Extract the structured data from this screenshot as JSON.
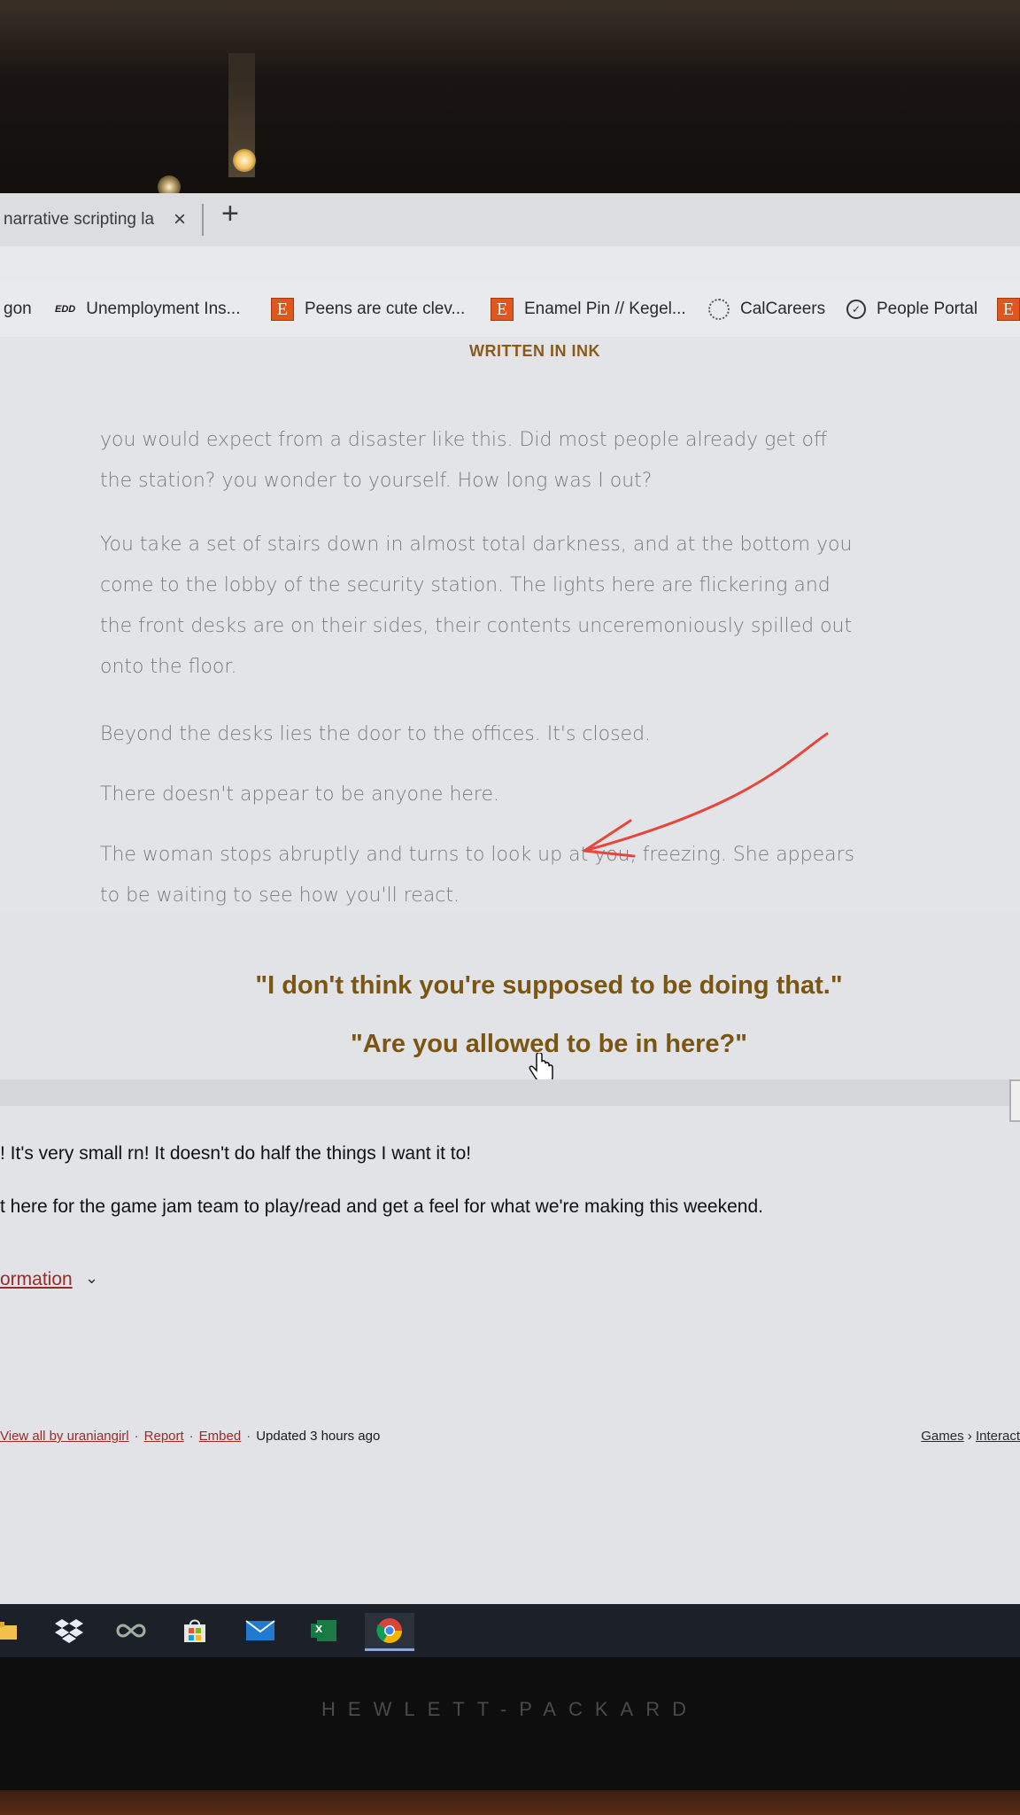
{
  "browser": {
    "tab_title": "narrative scripting la",
    "tab_close": "×",
    "new_tab": "+"
  },
  "bookmarks": [
    {
      "icon": "none",
      "label": "gon"
    },
    {
      "icon": "edd-icon",
      "icon_text": "EDD",
      "label": "Unemployment Ins..."
    },
    {
      "icon": "etsy-icon",
      "icon_text": "E",
      "label": "Peens are cute clev..."
    },
    {
      "icon": "etsy-icon",
      "icon_text": "E",
      "label": "Enamel Pin // Kegel..."
    },
    {
      "icon": "calcareers-icon",
      "label": "CalCareers"
    },
    {
      "icon": "people-portal-icon",
      "label": "People Portal"
    },
    {
      "icon": "etsy-icon",
      "icon_text": "E",
      "label": ""
    }
  ],
  "game": {
    "title": "WRITTEN IN INK",
    "paragraphs": [
      [
        "you would expect from a disaster like this. Did most people already get off",
        "the station? you wonder to yourself. How long was I out?"
      ],
      [
        "You take a set of stairs down in almost total darkness, and at the bottom you",
        "come to the lobby of the security station. The lights here are flickering and",
        "the front desks are on their sides, their contents unceremoniously spilled out",
        "onto the floor."
      ],
      [
        "Beyond the desks lies the door to the offices. It's closed."
      ],
      [
        "There doesn't appear to be anyone here."
      ],
      [
        "The woman stops abruptly and turns to look up at you, freezing. She appears",
        "to be waiting to see how you'll react."
      ]
    ],
    "choices": [
      "\"I don't think you're supposed to be doing that.\"",
      "\"Are you allowed to be in here?\""
    ],
    "annotation_color": "#e8463c"
  },
  "description": {
    "line1": "! It's very small rn! It doesn't do half the things I want it to!",
    "line2": "t here for the game jam team to play/read and get a feel for what we're making this weekend.",
    "more_info": "ormation"
  },
  "footer": {
    "view_all": "View all by uraniangirl",
    "report": "Report",
    "embed": "Embed",
    "updated": "Updated 3 hours ago",
    "breadcrumb_games": "Games",
    "breadcrumb_sep": "›",
    "breadcrumb_interactive": "Interact"
  },
  "taskbar": {
    "apps": [
      "file-explorer-icon",
      "dropbox-icon",
      "infinity-icon",
      "store-icon",
      "mail-icon",
      "excel-icon",
      "chrome-icon"
    ],
    "excel_letter": "x"
  },
  "monitor": {
    "brand": "HEWLETT-PACKARD"
  }
}
